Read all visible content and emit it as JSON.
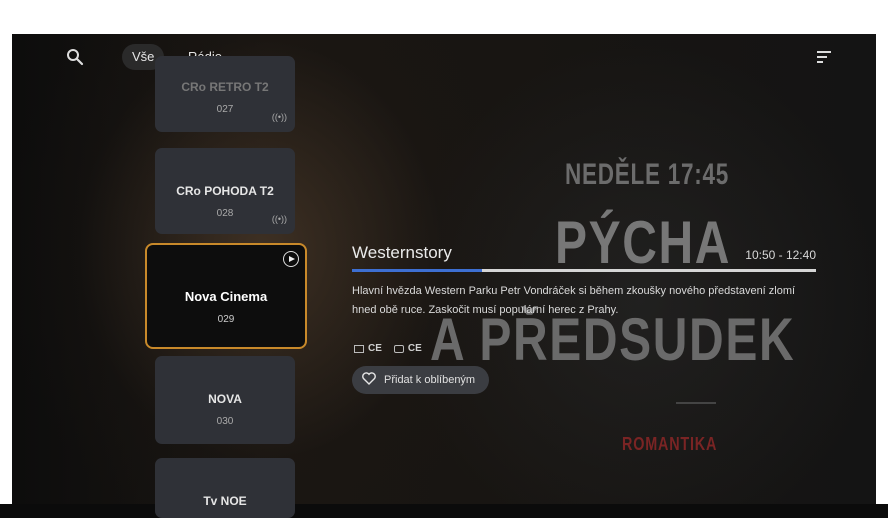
{
  "nav": {
    "search_icon": "search-icon",
    "tabs": [
      {
        "label": "Vše",
        "active": true
      },
      {
        "label": "Rádio",
        "active": false
      }
    ],
    "sort_icon": "sort-icon"
  },
  "channels": [
    {
      "name": "CRo RETRO T2",
      "number": "027",
      "radio_icon": "((•))"
    },
    {
      "name": "CRo POHODA T2",
      "number": "028",
      "radio_icon": "((•))"
    },
    {
      "name": "Nova Cinema",
      "number": "029",
      "focused": true
    },
    {
      "name": "NOVA",
      "number": "030"
    },
    {
      "name": "Tv NOE",
      "number": ""
    }
  ],
  "program": {
    "title": "Westernstory",
    "time": "10:50 - 12:40",
    "progress": 0.28,
    "description": "Hlavní hvězda Western Parku Petr Vondráček si během zkoušky nového představení zlomí hned obě ruce. Zaskočit musí populární herec z Prahy.",
    "tags": [
      {
        "label": "CE",
        "icon": "subtitles-icon"
      },
      {
        "label": "CE",
        "icon": "audio-track-icon"
      }
    ],
    "favorite_label": "Přidat k oblíbeným"
  },
  "poster": {
    "line1": "NEDĚLE 17:45",
    "line2": "PÝCHA",
    "line3": "A PŘEDSUDEK",
    "line4": "ROMANTIKA"
  },
  "colors": {
    "accent_focus": "#c8892a",
    "progress_fill": "#3d6fd2"
  }
}
